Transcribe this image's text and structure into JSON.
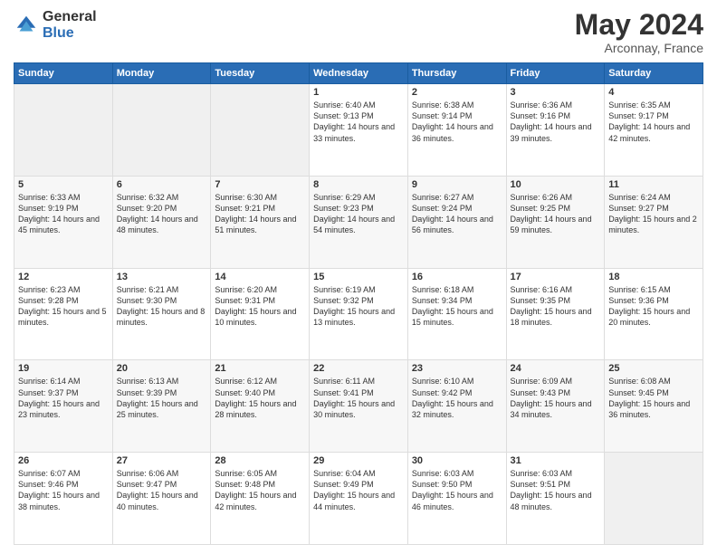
{
  "header": {
    "logo_general": "General",
    "logo_blue": "Blue",
    "month_year": "May 2024",
    "location": "Arconnay, France"
  },
  "weekdays": [
    "Sunday",
    "Monday",
    "Tuesday",
    "Wednesday",
    "Thursday",
    "Friday",
    "Saturday"
  ],
  "weeks": [
    [
      {
        "day": "",
        "info": ""
      },
      {
        "day": "",
        "info": ""
      },
      {
        "day": "",
        "info": ""
      },
      {
        "day": "1",
        "info": "Sunrise: 6:40 AM\nSunset: 9:13 PM\nDaylight: 14 hours\nand 33 minutes."
      },
      {
        "day": "2",
        "info": "Sunrise: 6:38 AM\nSunset: 9:14 PM\nDaylight: 14 hours\nand 36 minutes."
      },
      {
        "day": "3",
        "info": "Sunrise: 6:36 AM\nSunset: 9:16 PM\nDaylight: 14 hours\nand 39 minutes."
      },
      {
        "day": "4",
        "info": "Sunrise: 6:35 AM\nSunset: 9:17 PM\nDaylight: 14 hours\nand 42 minutes."
      }
    ],
    [
      {
        "day": "5",
        "info": "Sunrise: 6:33 AM\nSunset: 9:19 PM\nDaylight: 14 hours\nand 45 minutes."
      },
      {
        "day": "6",
        "info": "Sunrise: 6:32 AM\nSunset: 9:20 PM\nDaylight: 14 hours\nand 48 minutes."
      },
      {
        "day": "7",
        "info": "Sunrise: 6:30 AM\nSunset: 9:21 PM\nDaylight: 14 hours\nand 51 minutes."
      },
      {
        "day": "8",
        "info": "Sunrise: 6:29 AM\nSunset: 9:23 PM\nDaylight: 14 hours\nand 54 minutes."
      },
      {
        "day": "9",
        "info": "Sunrise: 6:27 AM\nSunset: 9:24 PM\nDaylight: 14 hours\nand 56 minutes."
      },
      {
        "day": "10",
        "info": "Sunrise: 6:26 AM\nSunset: 9:25 PM\nDaylight: 14 hours\nand 59 minutes."
      },
      {
        "day": "11",
        "info": "Sunrise: 6:24 AM\nSunset: 9:27 PM\nDaylight: 15 hours\nand 2 minutes."
      }
    ],
    [
      {
        "day": "12",
        "info": "Sunrise: 6:23 AM\nSunset: 9:28 PM\nDaylight: 15 hours\nand 5 minutes."
      },
      {
        "day": "13",
        "info": "Sunrise: 6:21 AM\nSunset: 9:30 PM\nDaylight: 15 hours\nand 8 minutes."
      },
      {
        "day": "14",
        "info": "Sunrise: 6:20 AM\nSunset: 9:31 PM\nDaylight: 15 hours\nand 10 minutes."
      },
      {
        "day": "15",
        "info": "Sunrise: 6:19 AM\nSunset: 9:32 PM\nDaylight: 15 hours\nand 13 minutes."
      },
      {
        "day": "16",
        "info": "Sunrise: 6:18 AM\nSunset: 9:34 PM\nDaylight: 15 hours\nand 15 minutes."
      },
      {
        "day": "17",
        "info": "Sunrise: 6:16 AM\nSunset: 9:35 PM\nDaylight: 15 hours\nand 18 minutes."
      },
      {
        "day": "18",
        "info": "Sunrise: 6:15 AM\nSunset: 9:36 PM\nDaylight: 15 hours\nand 20 minutes."
      }
    ],
    [
      {
        "day": "19",
        "info": "Sunrise: 6:14 AM\nSunset: 9:37 PM\nDaylight: 15 hours\nand 23 minutes."
      },
      {
        "day": "20",
        "info": "Sunrise: 6:13 AM\nSunset: 9:39 PM\nDaylight: 15 hours\nand 25 minutes."
      },
      {
        "day": "21",
        "info": "Sunrise: 6:12 AM\nSunset: 9:40 PM\nDaylight: 15 hours\nand 28 minutes."
      },
      {
        "day": "22",
        "info": "Sunrise: 6:11 AM\nSunset: 9:41 PM\nDaylight: 15 hours\nand 30 minutes."
      },
      {
        "day": "23",
        "info": "Sunrise: 6:10 AM\nSunset: 9:42 PM\nDaylight: 15 hours\nand 32 minutes."
      },
      {
        "day": "24",
        "info": "Sunrise: 6:09 AM\nSunset: 9:43 PM\nDaylight: 15 hours\nand 34 minutes."
      },
      {
        "day": "25",
        "info": "Sunrise: 6:08 AM\nSunset: 9:45 PM\nDaylight: 15 hours\nand 36 minutes."
      }
    ],
    [
      {
        "day": "26",
        "info": "Sunrise: 6:07 AM\nSunset: 9:46 PM\nDaylight: 15 hours\nand 38 minutes."
      },
      {
        "day": "27",
        "info": "Sunrise: 6:06 AM\nSunset: 9:47 PM\nDaylight: 15 hours\nand 40 minutes."
      },
      {
        "day": "28",
        "info": "Sunrise: 6:05 AM\nSunset: 9:48 PM\nDaylight: 15 hours\nand 42 minutes."
      },
      {
        "day": "29",
        "info": "Sunrise: 6:04 AM\nSunset: 9:49 PM\nDaylight: 15 hours\nand 44 minutes."
      },
      {
        "day": "30",
        "info": "Sunrise: 6:03 AM\nSunset: 9:50 PM\nDaylight: 15 hours\nand 46 minutes."
      },
      {
        "day": "31",
        "info": "Sunrise: 6:03 AM\nSunset: 9:51 PM\nDaylight: 15 hours\nand 48 minutes."
      },
      {
        "day": "",
        "info": ""
      }
    ]
  ]
}
